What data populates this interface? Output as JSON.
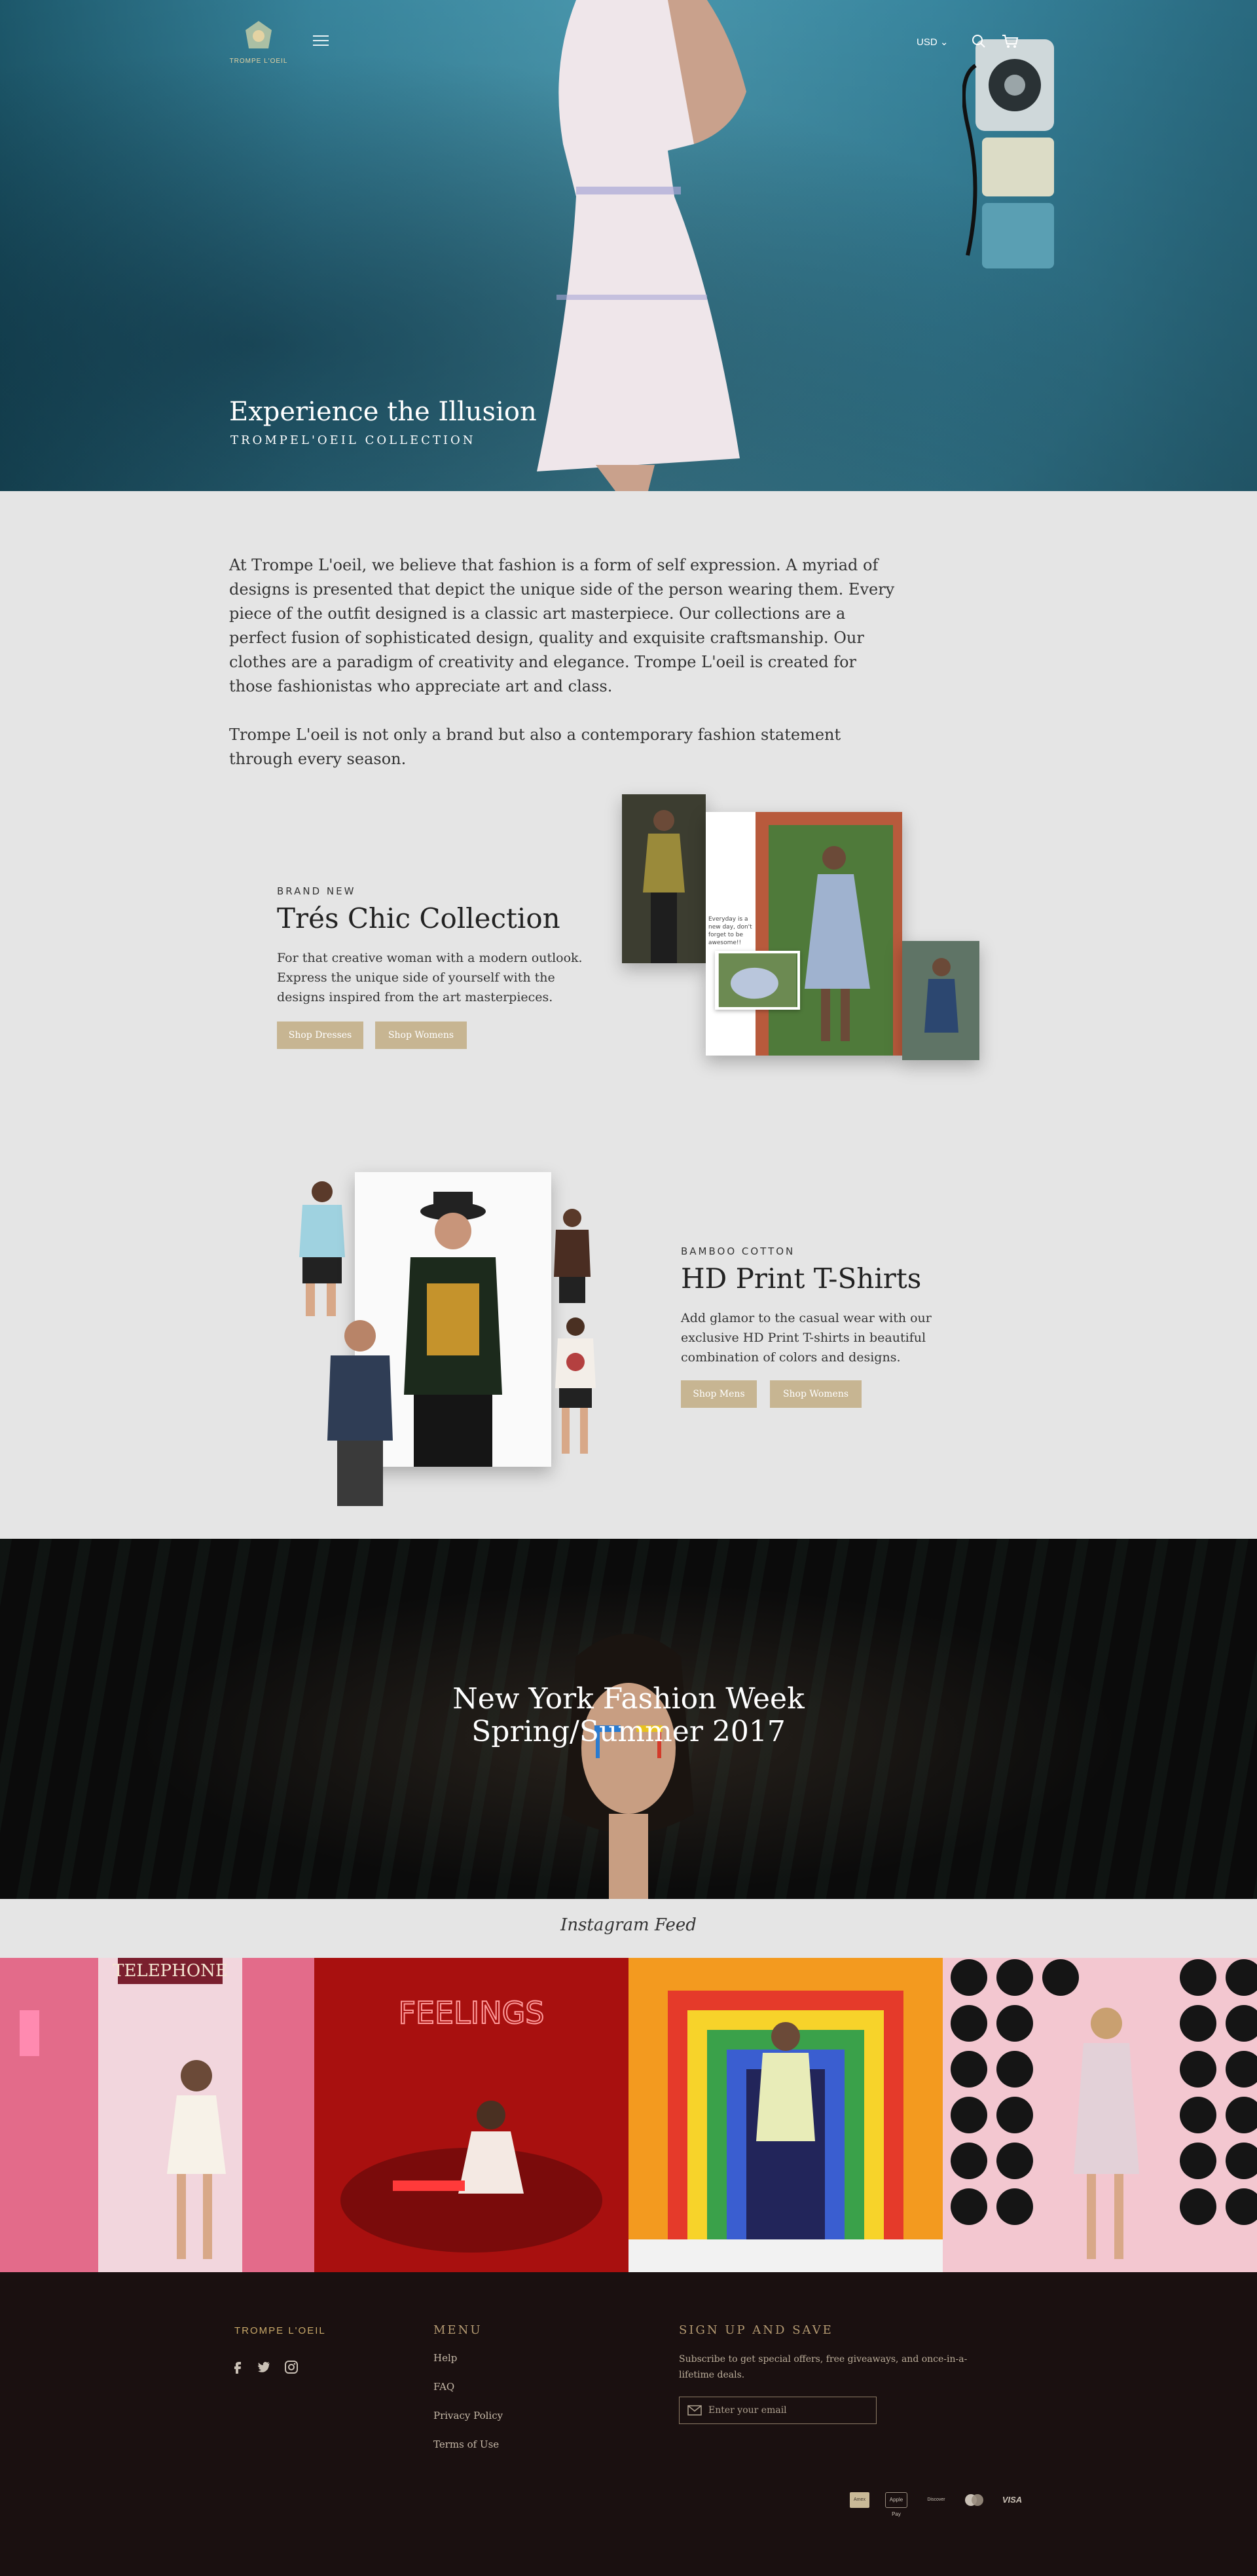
{
  "header": {
    "logo_text": "TROMPE L'OEIL",
    "currency": "USD",
    "currency_chevron": "⌄"
  },
  "hero": {
    "title": "Experience the Illusion",
    "subtitle": "TROMPEL'OEIL COLLECTION"
  },
  "intro": {
    "paragraph_1": "At Trompe L'oeil, we believe that fashion is a form of self expression. A myriad of designs is presented that depict the unique side of the person wearing them.  Every piece of the outfit designed is a classic art masterpiece. Our collections are a perfect fusion of sophisticated design, quality and exquisite craftsmanship. Our clothes are a paradigm of creativity and elegance. Trompe L'oeil is created for those fashionistas who appreciate art and class.",
    "paragraph_2": "Trompe L'oeil is not only a brand but also a contemporary fashion statement through every season."
  },
  "feature_chic": {
    "eyebrow": "BRAND NEW",
    "title": "Trés Chic Collection",
    "description": "For that creative woman with a modern outlook. Express the unique side of yourself with the designs inspired from the art masterpieces.",
    "button_1": "Shop Dresses",
    "button_2": "Shop Womens",
    "card_note": "Everyday is a new day, don't forget to be awesome!!"
  },
  "feature_tshirts": {
    "eyebrow": "BAMBOO COTTON",
    "title": "HD Print T-Shirts",
    "description": "Add glamor to the casual wear with our exclusive HD Print T-shirts in beautiful combination of colors and designs.",
    "button_1": "Shop Mens",
    "button_2": "Shop Womens"
  },
  "fashion_week": {
    "line_1": "New York Fashion Week",
    "line_2": "Spring/Summer 2017"
  },
  "instagram": {
    "title": "Instagram Feed",
    "tile_1_sign": "TELEPHONE",
    "tile_2_sign": "FEELINGS"
  },
  "footer": {
    "brand": "TROMPE L'OEIL",
    "menu_heading": "MENU",
    "menu_links": [
      "Help",
      "FAQ",
      "Privacy Policy",
      "Terms of Use"
    ],
    "signup_heading": "SIGN UP AND SAVE",
    "signup_text": "Subscribe to get special offers, free giveaways, and once-in-a-lifetime deals.",
    "email_placeholder": "Enter your email",
    "payments": [
      "Amex",
      "Apple Pay",
      "Discover",
      "Mastercard",
      "VISA"
    ]
  },
  "colors": {
    "accent_gold": "#c7b592",
    "footer_bg": "#1a1010",
    "page_bg": "#e5e5e5"
  },
  "icons": [
    "menu-icon",
    "search-icon",
    "cart-icon",
    "chevron-down-icon",
    "facebook-icon",
    "twitter-icon",
    "instagram-icon",
    "mail-icon"
  ]
}
